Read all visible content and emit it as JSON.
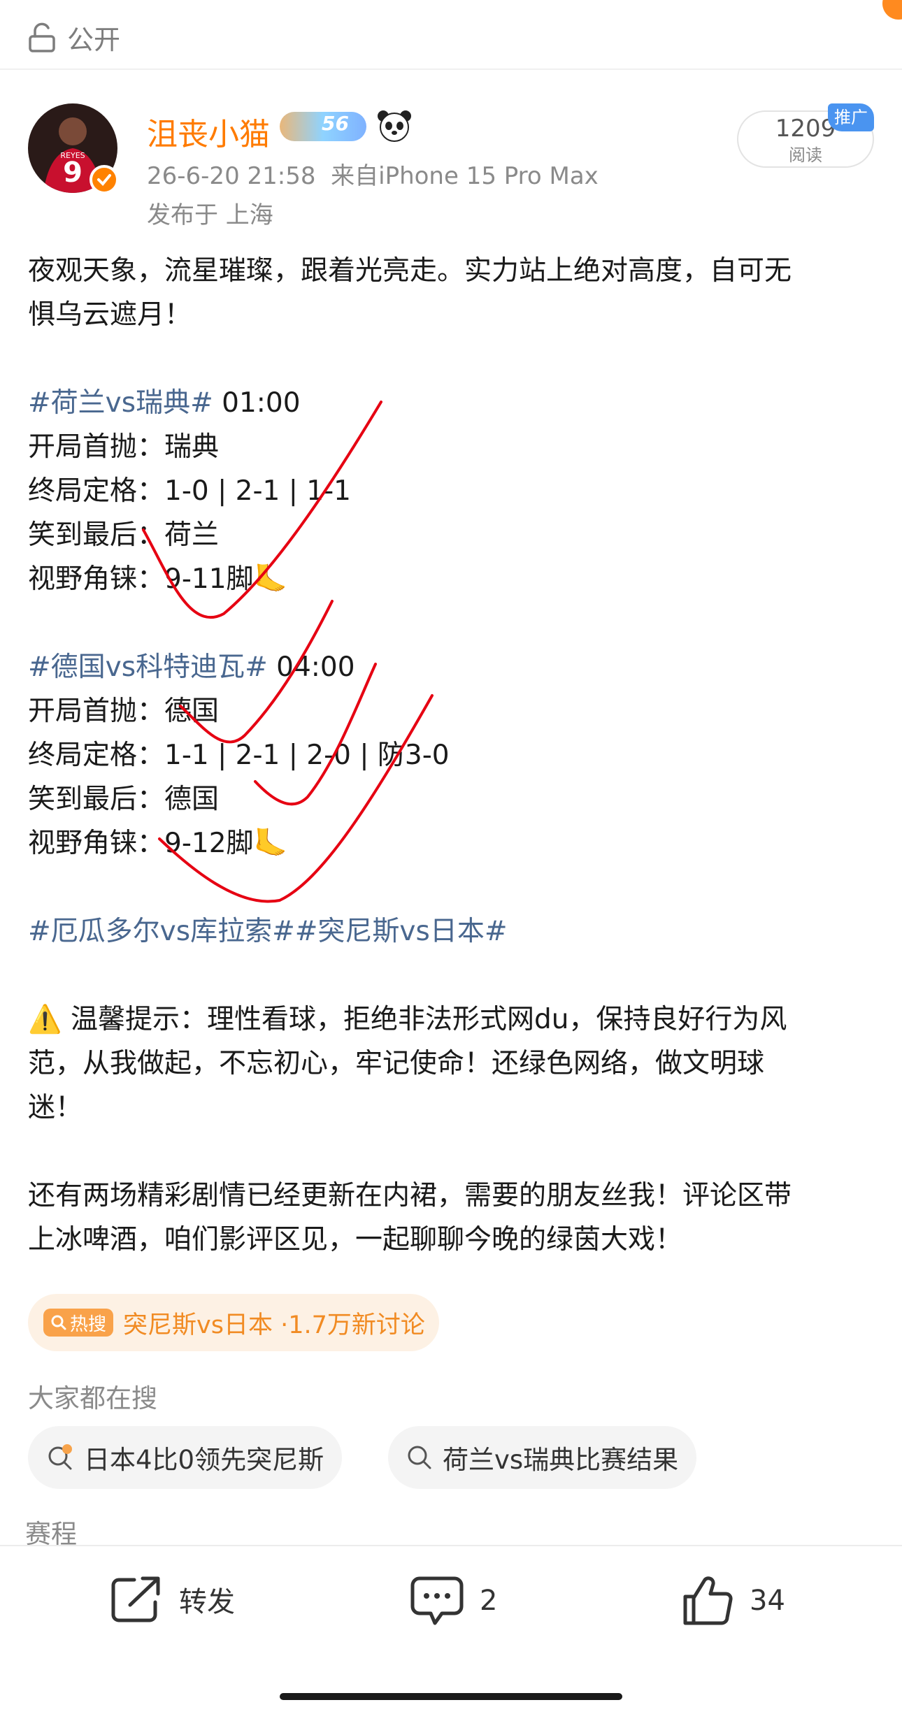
{
  "topbar": {
    "visibility_label": "公开"
  },
  "post": {
    "username": "沮丧小猫",
    "level": "56",
    "timestamp": "26-6-20 21:58",
    "source": "来自iPhone 15 Pro Max",
    "location": "发布于 上海",
    "reads_count": "1209",
    "reads_label": "阅读",
    "promo_label": "推广"
  },
  "content": {
    "lines": [
      {
        "topic": "",
        "text": "夜观天象，流星璀璨，跟着光亮走。实力站上绝对高度，自可无"
      },
      {
        "topic": "",
        "text": "惧乌云遮月！"
      },
      {
        "topic": "",
        "text": ""
      },
      {
        "topic": "#荷兰vs瑞典#",
        "text": " 01:00"
      },
      {
        "topic": "",
        "text": "开局首抛：瑞典"
      },
      {
        "topic": "",
        "text": "终局定格：1-0 | 2-1 | 1-1"
      },
      {
        "topic": "",
        "text": "笑到最后：荷兰"
      },
      {
        "topic": "",
        "text": "视野角铼：9-11脚🦶"
      },
      {
        "topic": "",
        "text": ""
      },
      {
        "topic": "#德国vs科特迪瓦#",
        "text": " 04:00"
      },
      {
        "topic": "",
        "text": "开局首抛：德国"
      },
      {
        "topic": "",
        "text": "终局定格：1-1 | 2-1 | 2-0 | 防3-0"
      },
      {
        "topic": "",
        "text": "笑到最后：德国"
      },
      {
        "topic": "",
        "text": "视野角铼：9-12脚🦶"
      },
      {
        "topic": "",
        "text": ""
      },
      {
        "topic": "#厄瓜多尔vs库拉索##突尼斯vs日本#",
        "text": ""
      },
      {
        "topic": "",
        "text": ""
      },
      {
        "topic": "",
        "text": "⚠️ 温馨提示：理性看球，拒绝非法形式网du，保持良好行为风"
      },
      {
        "topic": "",
        "text": "范，从我做起，不忘初心，牢记使命！还绿色网络，做文明球"
      },
      {
        "topic": "",
        "text": "迷！"
      },
      {
        "topic": "",
        "text": ""
      },
      {
        "topic": "",
        "text": "还有两场精彩剧情已经更新在内裙，需要的朋友丝我！评论区带"
      },
      {
        "topic": "",
        "text": "上冰啤酒，咱们影评区见，一起聊聊今晚的绿茵大戏！"
      }
    ]
  },
  "hot_search": {
    "tag": "热搜",
    "text": "突尼斯vs日本 ·1.7万新讨论"
  },
  "related": {
    "label": "大家都在搜",
    "items": [
      "日本4比0领先突尼斯",
      "荷兰vs瑞典比赛结果"
    ]
  },
  "schedule_label": "赛程",
  "actions": {
    "repost_label": "转发",
    "comment_count": "2",
    "like_count": "34"
  },
  "colors": {
    "accent": "#ff8200",
    "topic": "#49678f",
    "username": "#ff7b00",
    "handdrawn": "#e60012"
  }
}
